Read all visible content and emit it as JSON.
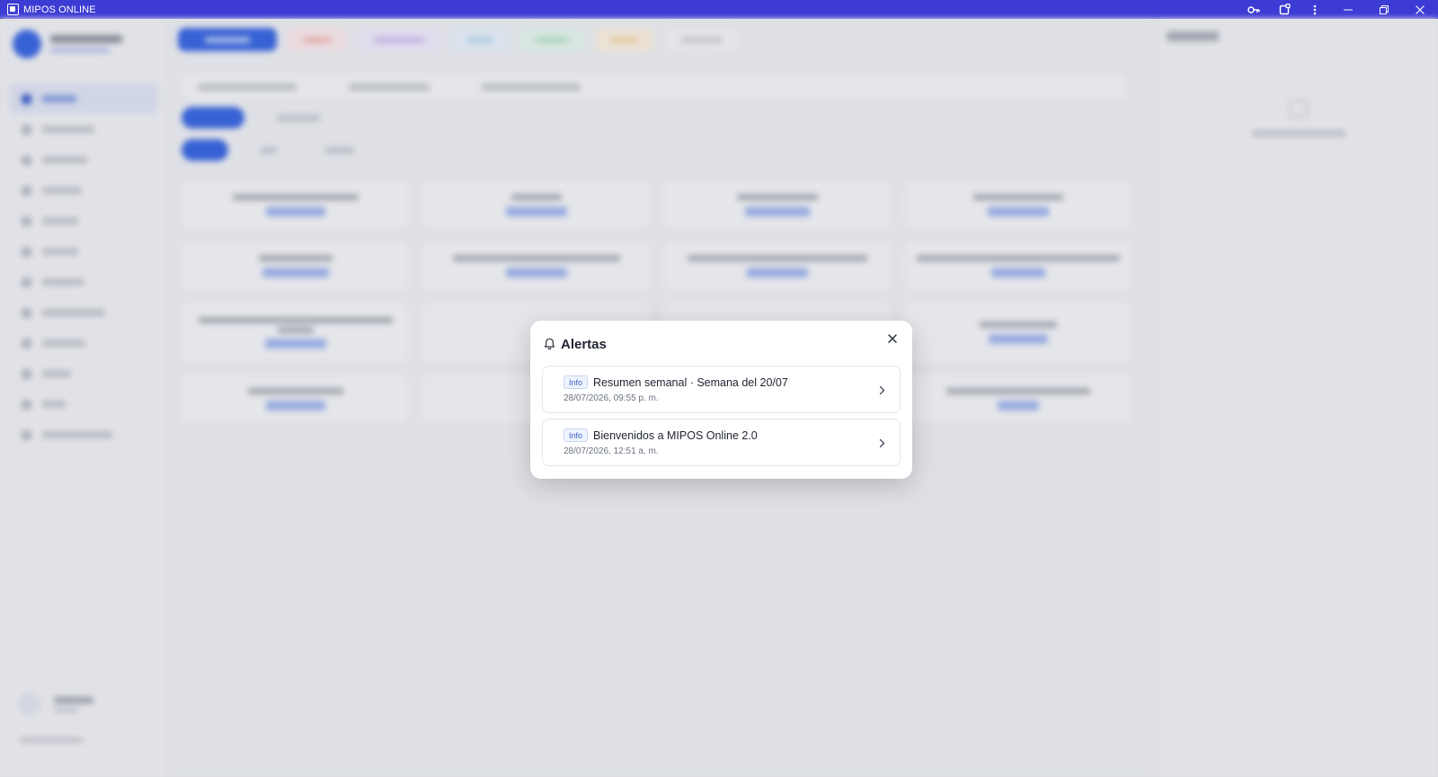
{
  "window": {
    "title": "MIPOS ONLINE",
    "controls": [
      "key-icon",
      "extension-icon",
      "more-vertical-icon",
      "minimize-icon",
      "restore-icon",
      "close-icon"
    ]
  },
  "colors": {
    "titlebar": "#3c3bd3",
    "accent": "#2e5fe0",
    "badge_text": "#3b62c8"
  },
  "alerts_modal": {
    "title": "Alertas",
    "items": [
      {
        "badge": "Info",
        "title": "Resumen semanal · Semana del 20/07",
        "date": "28/07/2026, 09:55 p. m."
      },
      {
        "badge": "Info",
        "title": "Bienvenidos a MIPOS Online 2.0",
        "date": "28/07/2026, 12:51 a. m."
      }
    ]
  }
}
